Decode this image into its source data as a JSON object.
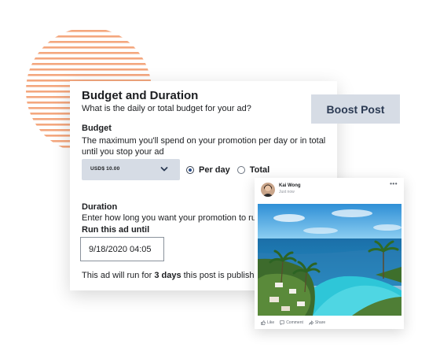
{
  "budget_card": {
    "title": "Budget and Duration",
    "subtitle": "What is the daily or total budget for your ad?",
    "budget_heading": "Budget",
    "budget_description": "The maximum you'll spend on your promotion per day or in total until you stop your ad",
    "budget_select_value": "USD$ 10.00",
    "radio_options": [
      {
        "label": "Per day",
        "checked": true
      },
      {
        "label": "Total",
        "checked": false
      }
    ],
    "duration_heading": "Duration",
    "duration_description": "Enter how long you want your promotion to run",
    "run_until_label": "Run this ad until",
    "run_until_value": "9/18/2020 04:05",
    "summary": {
      "prefix": "This ad will run for ",
      "highlight": "3 days",
      "suffix": " this post is published."
    }
  },
  "boost_button_label": "Boost Post",
  "post": {
    "author": "Kai Wong",
    "time": "Just now",
    "more_label": "•••",
    "actions": [
      {
        "label": "Like",
        "icon": "thumbs-up-icon"
      },
      {
        "label": "Comment",
        "icon": "comment-icon"
      },
      {
        "label": "Share",
        "icon": "share-icon"
      }
    ]
  },
  "colors": {
    "stripe": "#f4a77e",
    "select_bg": "#d6dce5",
    "button_text": "#2c3b54",
    "radio_checked": "#2d4f8a",
    "sea": "#1e7fb8",
    "pool": "#2ec6d8"
  }
}
